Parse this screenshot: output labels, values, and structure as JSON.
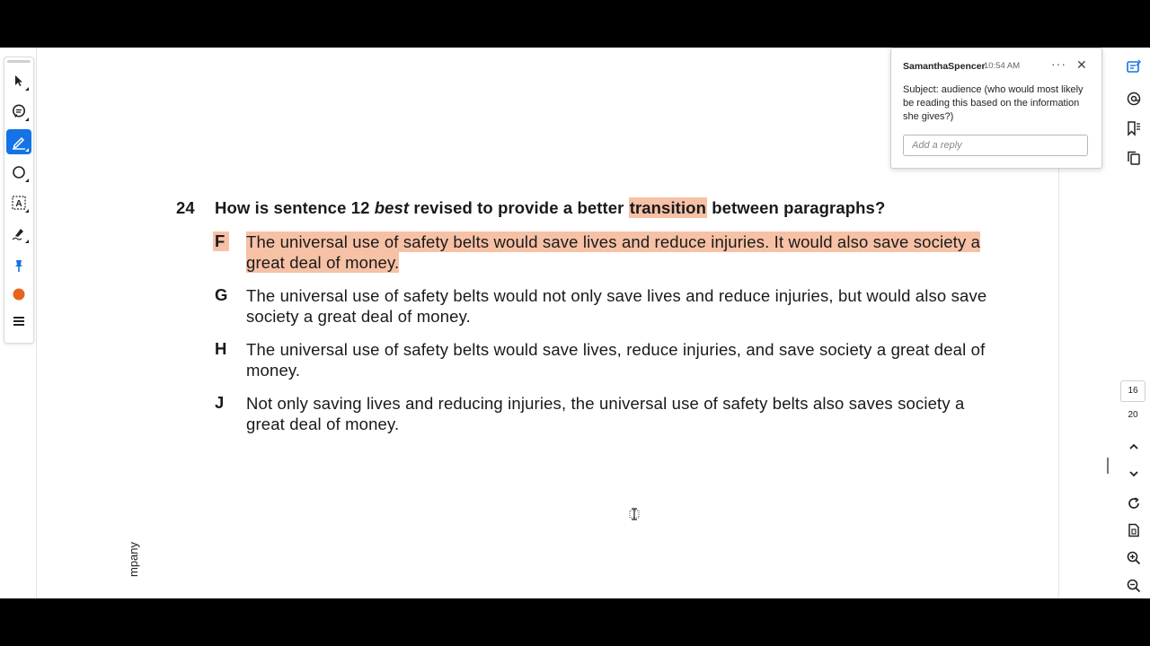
{
  "toolbar": {
    "tools": [
      {
        "name": "select-tool",
        "icon": "arrow-cursor-icon"
      },
      {
        "name": "comment-tool",
        "icon": "comment-icon"
      },
      {
        "name": "highlight-tool",
        "icon": "pen-highlight-icon",
        "active": true
      },
      {
        "name": "shape-tool",
        "icon": "circle-icon"
      },
      {
        "name": "text-tool",
        "icon": "text-box-icon"
      },
      {
        "name": "sign-tool",
        "icon": "sign-pen-icon"
      },
      {
        "name": "pin-tool",
        "icon": "pin-icon"
      },
      {
        "name": "color-tool",
        "icon": "color-dot-icon",
        "color": "#e8641e"
      },
      {
        "name": "more-tool",
        "icon": "menu-icon"
      }
    ],
    "accent_color": "#1473e6"
  },
  "document": {
    "question_number": "24",
    "question_before": "How is sentence 12 ",
    "question_emphasis": "best",
    "question_middle": " revised to provide a better ",
    "question_highlight": "transition",
    "question_after": " between paragraphs?",
    "answers": [
      {
        "letter": "F",
        "text": "The universal use of safety belts would save lives and reduce injuries. It would also save society a great deal of money.",
        "highlighted": true
      },
      {
        "letter": "G",
        "text": "The universal use of safety belts would not only save lives and reduce injuries, but would also save society a great deal of money."
      },
      {
        "letter": "H",
        "text": "The universal use of safety belts would save lives, reduce injuries, and save society a great deal of money."
      },
      {
        "letter": "J",
        "text": "Not only saving lives and reducing injuries, the universal use of safety belts also saves society a great deal of money."
      }
    ],
    "side_text": "mpany",
    "highlight_color": "#f7c1a6"
  },
  "comment": {
    "author": "SamanthaSpencer",
    "time": "10:54 AM",
    "more_label": "···",
    "close_label": "✕",
    "body": "Subject: audience (who would most likely be reading this based on the information she gives?)",
    "reply_placeholder": "Add a reply"
  },
  "right_panel": {
    "icons": [
      "comments-panel-icon",
      "share-icon",
      "bookmark-icon",
      "copy-pages-icon",
      "chevron-up-icon",
      "chevron-down-icon",
      "refresh-icon",
      "page-fit-icon",
      "zoom-in-icon",
      "zoom-out-icon"
    ],
    "current_page": "16",
    "total_pages": "20"
  }
}
